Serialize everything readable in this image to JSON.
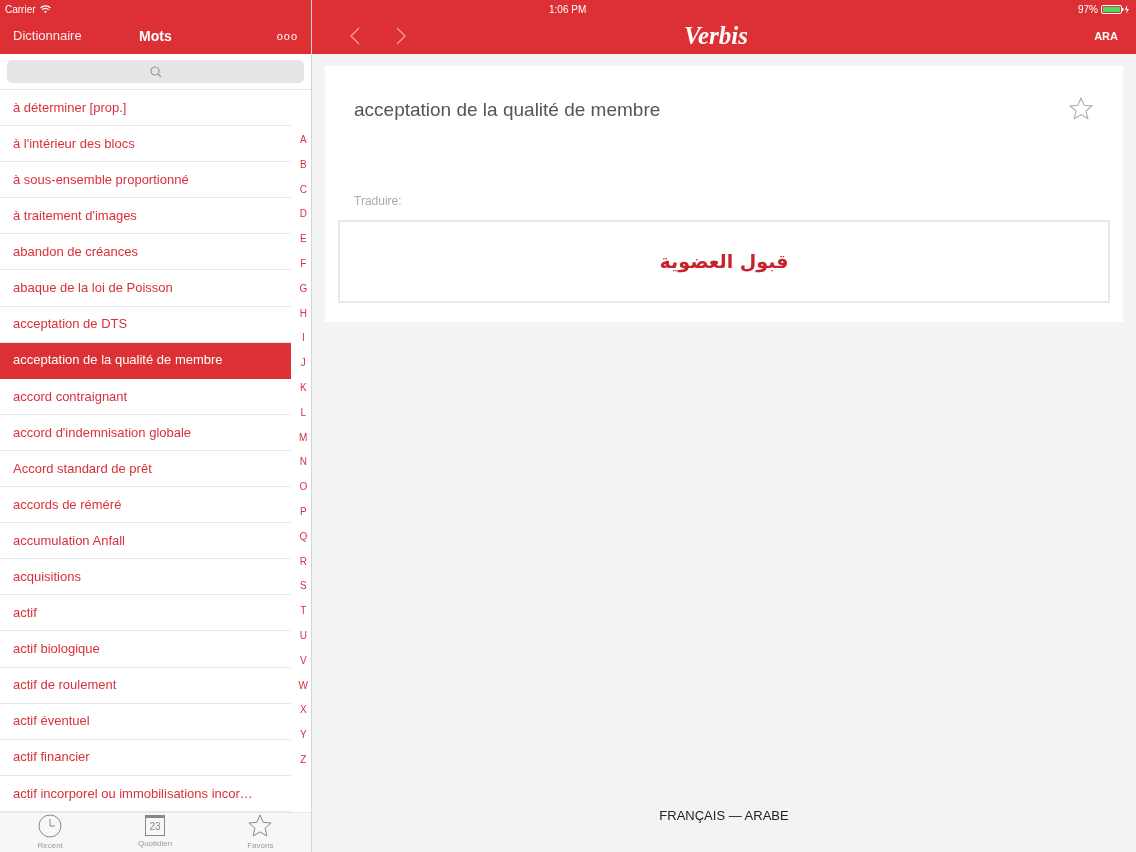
{
  "status_bar": {
    "carrier": "Carrier",
    "time": "1:06 PM",
    "battery": "97%"
  },
  "sidebar": {
    "back_label": "Dictionnaire",
    "title": "Mots",
    "more": "ooo",
    "items": [
      {
        "label": "à déterminer [prop.]",
        "selected": false
      },
      {
        "label": "à l'intérieur des blocs",
        "selected": false
      },
      {
        "label": "à sous-ensemble proportionné",
        "selected": false
      },
      {
        "label": "à traitement d'images",
        "selected": false
      },
      {
        "label": "abandon de créances",
        "selected": false
      },
      {
        "label": "abaque de la loi de Poisson",
        "selected": false
      },
      {
        "label": "acceptation de DTS",
        "selected": false
      },
      {
        "label": "acceptation de la qualité de membre",
        "selected": true
      },
      {
        "label": "accord contraignant",
        "selected": false
      },
      {
        "label": "accord d'indemnisation globale",
        "selected": false
      },
      {
        "label": "Accord standard de prêt",
        "selected": false
      },
      {
        "label": "accords de réméré",
        "selected": false
      },
      {
        "label": "accumulation Anfall",
        "selected": false
      },
      {
        "label": "acquisitions",
        "selected": false
      },
      {
        "label": "actif",
        "selected": false
      },
      {
        "label": "actif biologique",
        "selected": false
      },
      {
        "label": "actif de roulement",
        "selected": false
      },
      {
        "label": "actif éventuel",
        "selected": false
      },
      {
        "label": "actif financier",
        "selected": false
      },
      {
        "label": "actif incorporel ou immobilisations incor…",
        "selected": false
      }
    ],
    "index_letters": [
      "A",
      "B",
      "C",
      "D",
      "E",
      "F",
      "G",
      "H",
      "I",
      "J",
      "K",
      "L",
      "M",
      "N",
      "O",
      "P",
      "Q",
      "R",
      "S",
      "T",
      "U",
      "V",
      "W",
      "X",
      "Y",
      "Z"
    ],
    "tabs": [
      {
        "kind": "clock",
        "label": "Recent",
        "selected": false
      },
      {
        "kind": "calendar",
        "label": "Quotidien",
        "badge": "23",
        "selected": false
      },
      {
        "kind": "star",
        "label": "Favoris",
        "selected": false
      }
    ]
  },
  "main": {
    "app_title": "Verbis",
    "language_button": "ARA",
    "entry": {
      "term": "acceptation de la qualité de membre",
      "favorite": false,
      "translate_label": "Traduire:",
      "translation": "قبول العضوية"
    },
    "language_pair": "FRANÇAIS — ARABE"
  }
}
